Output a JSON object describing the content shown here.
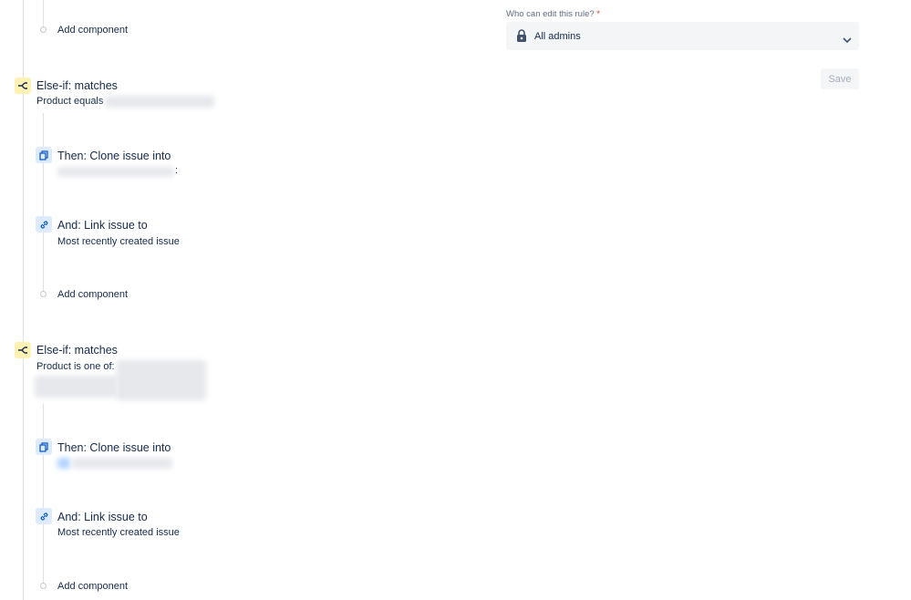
{
  "rule_sidebar": {
    "edit_permission_label": "Who can edit this rule?",
    "required_marker": "*",
    "edit_permission_value": "All admins",
    "save_label": "Save"
  },
  "flow": {
    "add_component_label": "Add component",
    "branches": [
      {
        "condition_title": "Else-if: matches",
        "condition_detail": "Product equals",
        "clone_title": "Then: Clone issue into",
        "clone_detail_suffix": ":",
        "link_title": "And: Link issue to",
        "link_detail": "Most recently created issue"
      },
      {
        "condition_title": "Else-if: matches",
        "condition_detail": "Product is one of:",
        "clone_title": "Then: Clone issue into",
        "link_title": "And: Link issue to",
        "link_detail": "Most recently created issue"
      }
    ]
  }
}
